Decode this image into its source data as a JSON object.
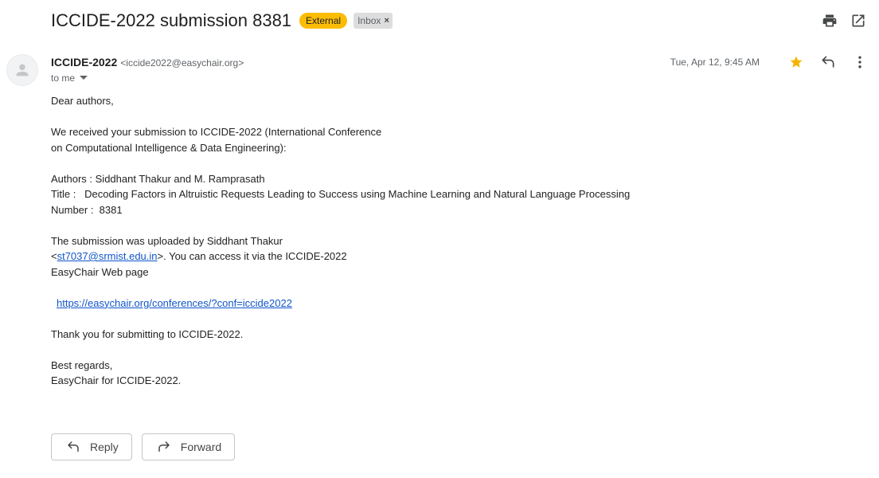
{
  "subject": "ICCIDE-2022 submission 8381",
  "labels": {
    "external": "External",
    "inbox": "Inbox",
    "inbox_remove": "×"
  },
  "sender": {
    "name": "ICCIDE-2022",
    "email": "<iccide2022@easychair.org>",
    "to": "to me"
  },
  "date": "Tue, Apr 12, 9:45 AM",
  "starred": true,
  "body": {
    "greeting": "Dear authors,",
    "intro_line1": "We received your submission to ICCIDE-2022 (International Conference",
    "intro_line2": "on Computational Intelligence & Data Engineering):",
    "authors": "Authors : Siddhant Thakur and M. Ramprasath",
    "title": "Title :   Decoding Factors in Altruistic Requests Leading to Success using Machine Learning and Natural Language Processing",
    "number": "Number :  8381",
    "upload_line1": "The submission was uploaded by Siddhant Thakur",
    "upload_lt": "<",
    "upload_email": "st7037@srmist.edu.in",
    "upload_rest": ">. You can access it via the ICCIDE-2022",
    "upload_line3": "EasyChair Web page",
    "conference_url": "https://easychair.org/conferences/?conf=iccide2022",
    "thanks": "Thank you for submitting to ICCIDE-2022.",
    "regards": "Best regards,",
    "signature": "EasyChair for ICCIDE-2022."
  },
  "actions": {
    "reply": "Reply",
    "forward": "Forward"
  },
  "colors": {
    "external_label": "#fbbc04",
    "link": "#1155cc",
    "star": "#f4b400"
  }
}
